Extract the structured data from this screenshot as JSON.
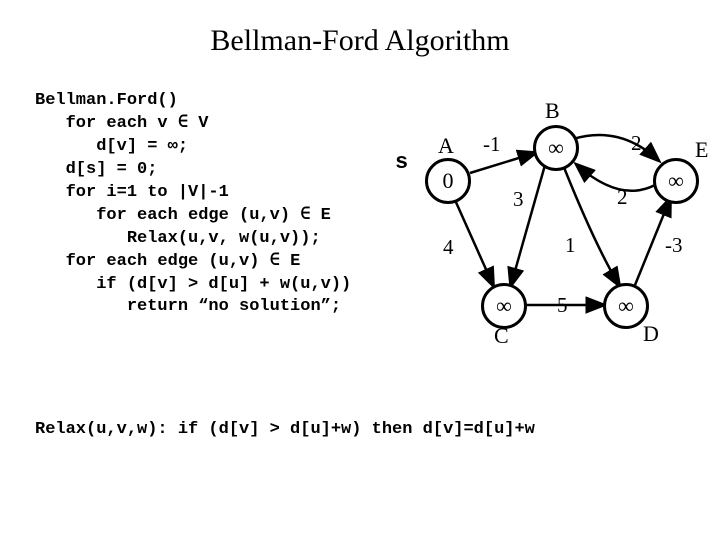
{
  "title": "Bellman-Ford Algorithm",
  "code": "Bellman.Ford()\n   for each v ∈ V\n      d[v] = ∞;\n   d[s] = 0;\n   for i=1 to |V|-1\n      for each edge (u,v) ∈ E\n         Relax(u,v, w(u,v));\n   for each edge (u,v) ∈ E\n      if (d[v] > d[u] + w(u,v))\n         return “no solution”;",
  "relax": "Relax(u,v,w): if (d[v] > d[u]+w) then d[v]=d[u]+w",
  "source_label": "s",
  "nodes": {
    "A": {
      "label": "A",
      "value": "0"
    },
    "B": {
      "label": "B",
      "value": "∞"
    },
    "C": {
      "label": "C",
      "value": "∞"
    },
    "D": {
      "label": "D",
      "value": "∞"
    },
    "E": {
      "label": "E",
      "value": "∞"
    }
  },
  "edges": {
    "AB": "-1",
    "AC": "4",
    "BC": "3",
    "BD": "1",
    "BE": "2",
    "EB": "2",
    "CD": "5",
    "DE": "-3"
  }
}
